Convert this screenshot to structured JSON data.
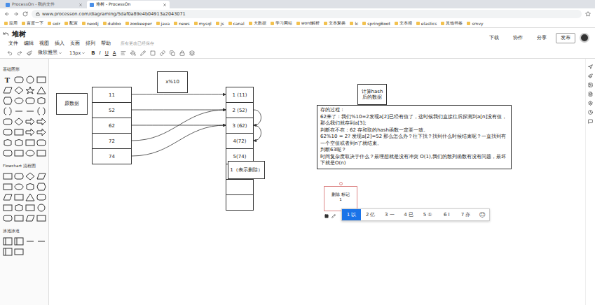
{
  "browser": {
    "tabs": [
      {
        "label": "ProcessOn - 我的文件",
        "selected": false
      },
      {
        "label": "堆树 - ProcessOn",
        "selected": true
      }
    ],
    "url": "www.processon.com/diagraming/5daf0a89e4b04913a2043071",
    "bookmarks": [
      "应用",
      "百度一下",
      "solr",
      "配置",
      "neo4j",
      "dubbo",
      "zookeeper",
      "java",
      "news",
      "mysql",
      "js",
      "canal",
      "大数据",
      "学习网站",
      "word解析",
      "文本聚类",
      "lc",
      "springBoot",
      "文本相",
      "elastics",
      "其他书签",
      "smvy"
    ]
  },
  "app": {
    "title": "堆树",
    "menu": [
      "文件",
      "编辑",
      "视图",
      "插入",
      "页面",
      "排列",
      "帮助"
    ],
    "save_status": "所有更改已经保存",
    "actions": [
      "下载",
      "协作",
      "分享",
      "发布"
    ]
  },
  "toolbar": {
    "font": "微软雅黑",
    "size": "13px",
    "format": [
      "B",
      "I",
      "U",
      "A"
    ]
  },
  "sidebar": {
    "text_tool": "T",
    "sections": [
      "基础图形",
      "Flowchart 流程图",
      "泳池泳道"
    ]
  },
  "diagram": {
    "source_label": "原数据",
    "func_label": "x%10",
    "hash_label": [
      "计算hash",
      "后的数据"
    ],
    "values": [
      "11",
      "52",
      "62",
      "72",
      "74"
    ],
    "slots": [
      "1 (11)",
      "2 (52)",
      "3 (62)",
      "4(72)",
      "5(74)",
      "",
      "",
      ""
    ],
    "deleted_note": "1（表示删除）",
    "notes": [
      "存的过程：",
      "62来了：我们%10=2发现a[2]已经有值了，这时候我们直接往后探测到a[n]没有值，那么我们就存到a[3];",
      "判断在不在：62 存和取的hash函数一定要一致。",
      "62%10 = 2? 发现a[2]=52 那么怎么办？往下找？找到什么时候结束呢？一直找到有一个空值或者到n了就结束。",
      "判断63呢？",
      "时间复杂度取决于什么？最理想就是没有冲突 O(1),我们的散列函数有没有问题，最坏下就是O(n)"
    ]
  },
  "ime": {
    "composition": [
      "删除 标记",
      "1"
    ],
    "candidates": [
      {
        "num": "1",
        "text": "以",
        "selected": true
      },
      {
        "num": "2",
        "text": "亿",
        "selected": false
      },
      {
        "num": "3",
        "text": "一",
        "selected": false
      },
      {
        "num": "4",
        "text": "已",
        "selected": false
      },
      {
        "num": "5",
        "text": "①",
        "selected": false
      },
      {
        "num": "6",
        "text": "Ⅰ",
        "selected": false
      },
      {
        "num": "7",
        "text": "亦",
        "selected": false
      }
    ],
    "emoji": "☺"
  }
}
